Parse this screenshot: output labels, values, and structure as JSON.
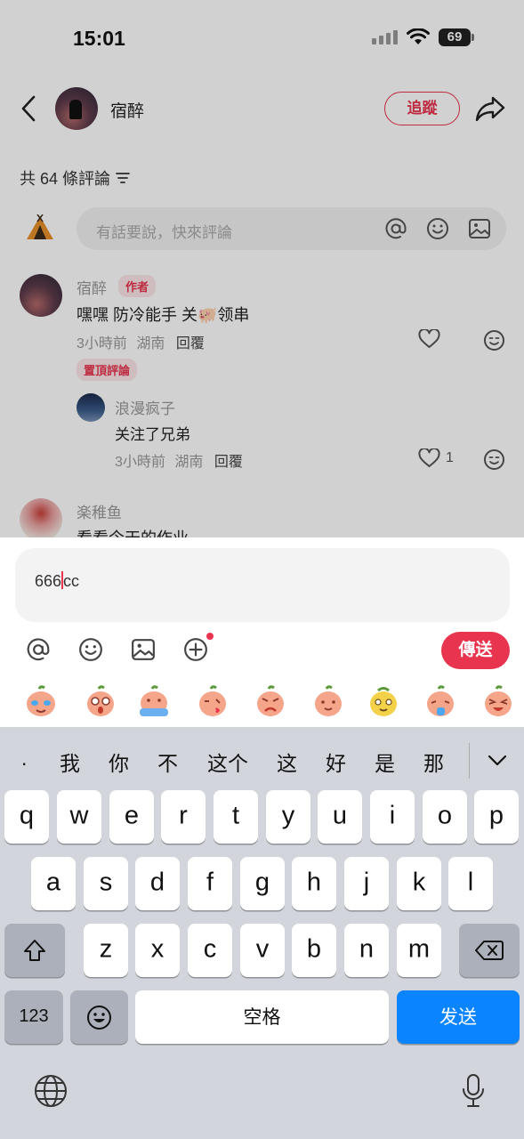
{
  "status": {
    "time": "15:01",
    "battery": "69"
  },
  "header": {
    "author": "宿醉",
    "follow_label": "追蹤"
  },
  "comments_count": "共 64 條評論",
  "comment_input": {
    "placeholder": "有話要說，快來評論"
  },
  "comments": [
    {
      "name": "宿醉",
      "author_tag": "作者",
      "text": "嘿嘿 防冷能手 关🐖领串",
      "time": "3小時前",
      "location": "湖南",
      "reply": "回覆",
      "pinned_tag": "置頂評論"
    },
    {
      "name": "浪漫疯子",
      "text": "关注了兄弟",
      "time": "3小時前",
      "location": "湖南",
      "reply": "回覆",
      "likes": "1"
    },
    {
      "name": "楽稚鱼",
      "text": "看看今天的作业"
    }
  ],
  "composer": {
    "value_before": "666",
    "value_after": "cc",
    "send_label": "傳送"
  },
  "candidates": [
    ".",
    "我",
    "你",
    "不",
    "这个",
    "这",
    "好",
    "是",
    "那"
  ],
  "keyboard": {
    "row1": [
      "q",
      "w",
      "e",
      "r",
      "t",
      "y",
      "u",
      "i",
      "o",
      "p"
    ],
    "row2": [
      "a",
      "s",
      "d",
      "f",
      "g",
      "h",
      "j",
      "k",
      "l"
    ],
    "row3": [
      "z",
      "x",
      "c",
      "v",
      "b",
      "n",
      "m"
    ],
    "numbers_label": "123",
    "space_label": "空格",
    "send_label": "发送"
  },
  "colors": {
    "accent": "#e8344e",
    "keyboard_send": "#0b84ff"
  }
}
